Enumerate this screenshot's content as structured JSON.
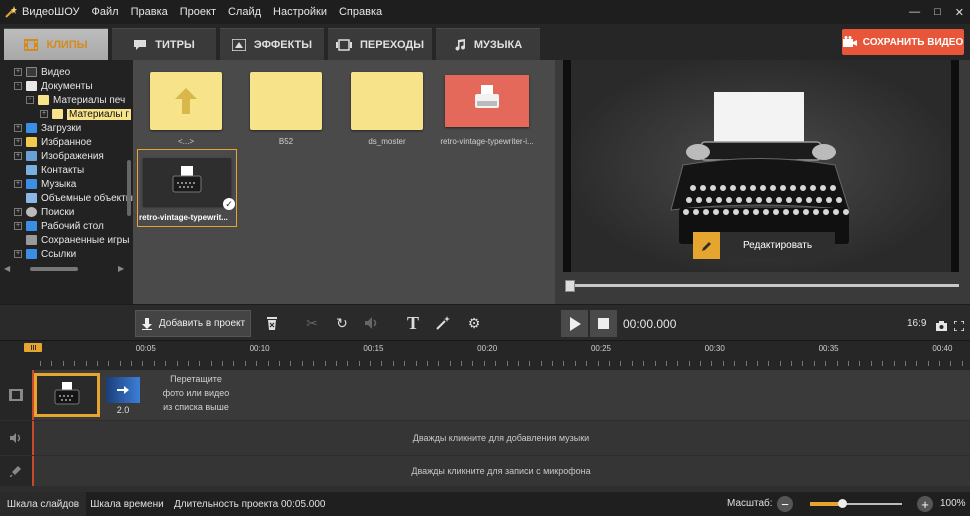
{
  "app": {
    "name_prefix": "Видео",
    "name_suffix": "ШОУ",
    "menu": [
      "Файл",
      "Правка",
      "Проект",
      "Слайд",
      "Настройки",
      "Справка"
    ]
  },
  "tabs": [
    {
      "label": "КЛИПЫ",
      "icon": "film-icon",
      "active": true
    },
    {
      "label": "ТИТРЫ",
      "icon": "chat-icon",
      "active": false
    },
    {
      "label": "ЭФФЕКТЫ",
      "icon": "effects-icon",
      "active": false
    },
    {
      "label": "ПЕРЕХОДЫ",
      "icon": "transition-icon",
      "active": false
    },
    {
      "label": "МУЗЫКА",
      "icon": "music-icon",
      "active": false
    }
  ],
  "save_button": {
    "label": "СОХРАНИТЬ ВИДЕО"
  },
  "tree": [
    {
      "label": "Видео",
      "expander": "+",
      "level": 1
    },
    {
      "label": "Документы",
      "expander": "-",
      "level": 1
    },
    {
      "label": "Материалы печ",
      "expander": "-",
      "level": 2
    },
    {
      "label": "Материалы г",
      "expander": "+",
      "level": 3,
      "selected": true
    },
    {
      "label": "Загрузки",
      "expander": "+",
      "level": 1
    },
    {
      "label": "Избранное",
      "expander": "+",
      "level": 1
    },
    {
      "label": "Изображения",
      "expander": "+",
      "level": 1
    },
    {
      "label": "Контакты",
      "expander": "",
      "level": 1
    },
    {
      "label": "Музыка",
      "expander": "+",
      "level": 1
    },
    {
      "label": "Объемные объекты",
      "expander": "",
      "level": 1
    },
    {
      "label": "Поиски",
      "expander": "+",
      "level": 1
    },
    {
      "label": "Рабочий стол",
      "expander": "+",
      "level": 1
    },
    {
      "label": "Сохраненные игры",
      "expander": "",
      "level": 1
    },
    {
      "label": "Ссылки",
      "expander": "+",
      "level": 1
    }
  ],
  "files": [
    {
      "label": "<...>",
      "type": "up"
    },
    {
      "label": "B52",
      "type": "folder"
    },
    {
      "label": "ds_moster",
      "type": "folder"
    },
    {
      "label": "retro-vintage-typewriter-i...",
      "type": "image-red"
    },
    {
      "label": "retro-vintage-typewrit...",
      "type": "image-dark",
      "selected": true
    }
  ],
  "preview": {
    "edit_label": "Редактировать"
  },
  "toolbar": {
    "add_label": "Добавить в проект"
  },
  "playback": {
    "time": "00:00.000",
    "aspect": "16:9"
  },
  "ruler": {
    "labels": [
      "00:05",
      "00:10",
      "00:15",
      "00:20",
      "00:25",
      "00:30",
      "00:35",
      "00:40"
    ]
  },
  "timeline": {
    "transition_duration": "2.0",
    "drop_hint": [
      "Перетащите",
      "фото или видео",
      "из списка выше"
    ],
    "music_hint": "Дважды кликните для добавления музыки",
    "mic_hint": "Дважды кликните для записи с микрофона"
  },
  "status": {
    "slides_tab": "Шкала слайдов",
    "timeline_tab": "Шкала времени",
    "duration": "Длительность проекта 00:05.000",
    "zoom_label": "Масштаб:",
    "zoom_value": "100%",
    "zoom_fraction": 0.35
  },
  "colors": {
    "accent": "#e6a52e",
    "save": "#e8563a"
  }
}
